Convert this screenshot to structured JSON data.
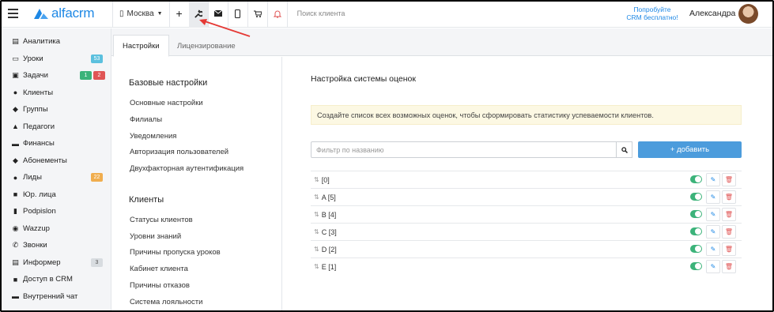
{
  "topbar": {
    "logo_text": "alfacrm",
    "branch": "Москва",
    "search_placeholder": "Поиск клиента",
    "try_line1": "Попробуйте",
    "try_line2": "CRM бесплатно!",
    "user_name": "Александра",
    "icons": [
      "menu-icon",
      "building-icon",
      "plus-icon",
      "wrench-icon",
      "mail-icon",
      "phone-icon",
      "cart-icon",
      "bell-icon"
    ]
  },
  "sidebar": {
    "items": [
      {
        "label": "Аналитика",
        "icon": "analytics-icon"
      },
      {
        "label": "Уроки",
        "icon": "calendar-icon",
        "badge": "53",
        "badge_color": "#5bc0de"
      },
      {
        "label": "Задачи",
        "icon": "tasks-icon",
        "badge": "1",
        "badge_color": "#3cb37a",
        "badge2": "2",
        "badge2_color": "#e05555"
      },
      {
        "label": "Клиенты",
        "icon": "user-icon"
      },
      {
        "label": "Группы",
        "icon": "users-icon"
      },
      {
        "label": "Педагоги",
        "icon": "graduation-icon"
      },
      {
        "label": "Финансы",
        "icon": "money-icon"
      },
      {
        "label": "Абонементы",
        "icon": "tag-icon"
      },
      {
        "label": "Лиды",
        "icon": "user-plus-icon",
        "badge": "22",
        "badge_color": "#f0ad4e"
      },
      {
        "label": "Юр. лица",
        "icon": "briefcase-icon"
      },
      {
        "label": "Podpislon",
        "icon": "document-icon"
      },
      {
        "label": "Wazzup",
        "icon": "whatsapp-icon"
      },
      {
        "label": "Звонки",
        "icon": "phone-call-icon"
      },
      {
        "label": "Информер",
        "icon": "newspaper-icon",
        "badge": "3",
        "badge_color": "#d8dce0"
      },
      {
        "label": "Доступ в CRM",
        "icon": "lock-icon"
      },
      {
        "label": "Внутренний чат",
        "icon": "chat-icon"
      }
    ]
  },
  "tabs": [
    "Настройки",
    "Лицензирование"
  ],
  "left_panel": {
    "section1_title": "Базовые настройки",
    "section1_items": [
      "Основные настройки",
      "Филиалы",
      "Уведомления",
      "Авторизация пользователей",
      "Двухфакторная аутентификация"
    ],
    "section2_title": "Клиенты",
    "section2_items": [
      "Статусы клиентов",
      "Уровни знаний",
      "Причины пропуска уроков",
      "Кабинет клиента",
      "Причины отказов",
      "Система лояльности"
    ]
  },
  "content": {
    "title": "Настройка системы оценок",
    "notice": "Создайте список всех возможных оценок, чтобы сформировать статистику успеваемости клиентов.",
    "filter_placeholder": "Фильтр по названию",
    "add_label": "+ добавить",
    "grades": [
      "[0]",
      "A [5]",
      "B [4]",
      "C [3]",
      "D [2]",
      "E [1]"
    ]
  },
  "colors": {
    "accent": "#1e88e5",
    "add_button": "#4c9cdc",
    "toggle_on": "#3cb37a",
    "notice_bg": "#fcf8e3"
  }
}
